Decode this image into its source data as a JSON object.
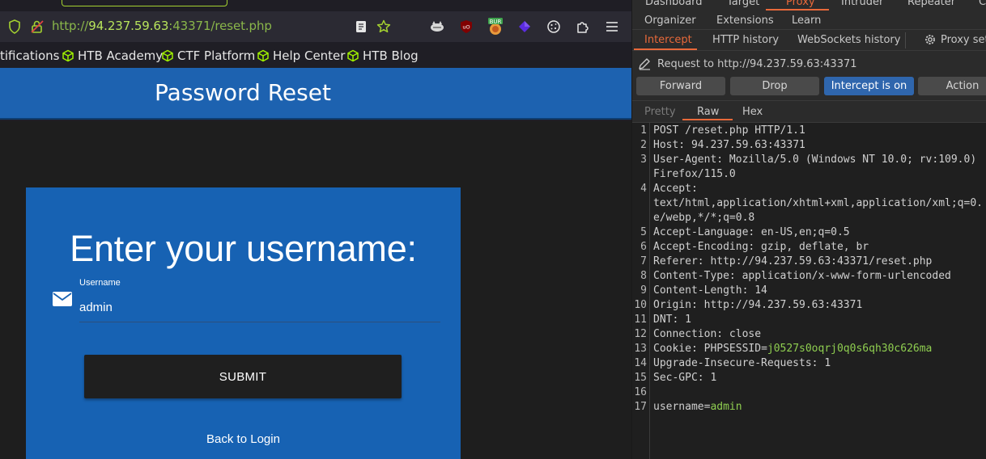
{
  "browser": {
    "url_scheme": "http://",
    "url_host": "94.237.59.63",
    "url_rest": ":43371/reset.php",
    "bookmarks": [
      "tifications",
      "HTB Academy",
      "CTF Platform",
      "Help Center",
      "HTB Blog"
    ],
    "extension_badge": "BUR"
  },
  "app": {
    "header_title": "Password Reset",
    "card_heading": "Enter your username:",
    "field_label": "Username",
    "field_value": "admin",
    "submit_label": "SUBMIT",
    "back_link": "Back to Login"
  },
  "burp": {
    "top_tabs": [
      "Dashboard",
      "Target",
      "Proxy",
      "Intruder",
      "Repeater",
      "C"
    ],
    "row2_tabs": [
      "Organizer",
      "Extensions",
      "Learn"
    ],
    "proxy_tabs": [
      "Intercept",
      "HTTP history",
      "WebSockets history"
    ],
    "proxy_settings": "Proxy sett",
    "request_to": "Request to http://94.237.59.63:43371",
    "buttons": {
      "forward": "Forward",
      "drop": "Drop",
      "intercept": "Intercept is on",
      "action": "Action"
    },
    "view_tabs": [
      "Pretty",
      "Raw",
      "Hex"
    ],
    "lines": [
      {
        "n": "1",
        "k": "POST /reset.php HTTP/1.1",
        "v": ""
      },
      {
        "n": "2",
        "k": "Host:",
        "v": " 94.237.59.63:43371"
      },
      {
        "n": "3",
        "k": "User-Agent:",
        "v": " Mozilla/5.0 (Windows NT 10.0; rv:109.0)"
      },
      {
        "n": "",
        "k": "",
        "v": "Firefox/115.0"
      },
      {
        "n": "4",
        "k": "Accept:",
        "v": ""
      },
      {
        "n": "",
        "k": "",
        "v": "text/html,application/xhtml+xml,application/xml;q=0."
      },
      {
        "n": "",
        "k": "",
        "v": "e/webp,*/*;q=0.8"
      },
      {
        "n": "5",
        "k": "Accept-Language:",
        "v": " en-US,en;q=0.5"
      },
      {
        "n": "6",
        "k": "Accept-Encoding:",
        "v": " gzip, deflate, br"
      },
      {
        "n": "7",
        "k": "Referer:",
        "v": " http://94.237.59.63:43371/reset.php"
      },
      {
        "n": "8",
        "k": "Content-Type:",
        "v": " application/x-www-form-urlencoded"
      },
      {
        "n": "9",
        "k": "Content-Length:",
        "v": " 14"
      },
      {
        "n": "10",
        "k": "Origin:",
        "v": " http://94.237.59.63:43371"
      },
      {
        "n": "11",
        "k": "DNT:",
        "v": " 1"
      },
      {
        "n": "12",
        "k": "Connection:",
        "v": " close"
      },
      {
        "n": "13",
        "k": "Cookie:",
        "v": " PHPSESSID=",
        "g": "j0527s0oqrj0q0s6qh30c626ma"
      },
      {
        "n": "14",
        "k": "Upgrade-Insecure-Requests:",
        "v": " 1"
      },
      {
        "n": "15",
        "k": "Sec-GPC:",
        "v": " 1"
      },
      {
        "n": "16",
        "k": "",
        "v": ""
      },
      {
        "n": "17",
        "k": "username=",
        "v": "",
        "g": "admin"
      }
    ]
  }
}
